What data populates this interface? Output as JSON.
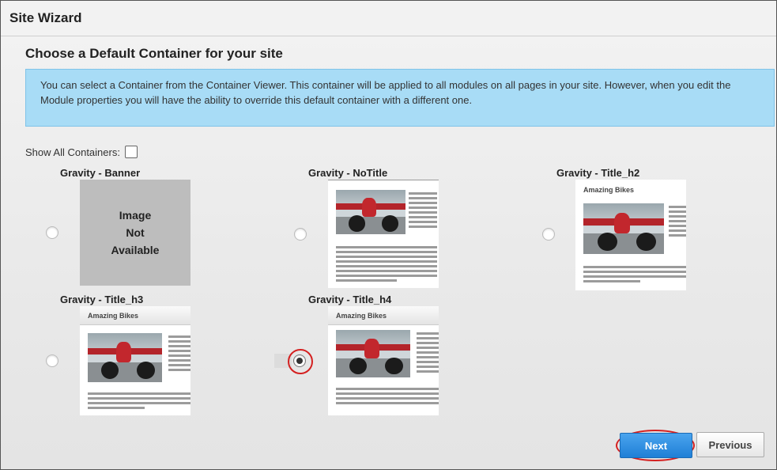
{
  "window": {
    "title": "Site Wizard"
  },
  "heading": "Choose a Default Container for your site",
  "info_text": "You can select a Container from the Container Viewer. This container will be applied to all modules on all pages in your site. However, when you edit the Module properties you will have the ability to override this default container with a different one.",
  "show_all": {
    "label": "Show All Containers:",
    "checked": false
  },
  "no_image": {
    "line1": "Image",
    "line2": "Not",
    "line3": "Available"
  },
  "thumb_title": "Amazing Bikes",
  "containers": [
    {
      "name": "Gravity - Banner",
      "selected": false
    },
    {
      "name": "Gravity - NoTitle",
      "selected": false
    },
    {
      "name": "Gravity - Title_h2",
      "selected": false
    },
    {
      "name": "Gravity - Title_h3",
      "selected": false
    },
    {
      "name": "Gravity - Title_h4",
      "selected": true
    }
  ],
  "buttons": {
    "next": "Next",
    "previous": "Previous"
  }
}
